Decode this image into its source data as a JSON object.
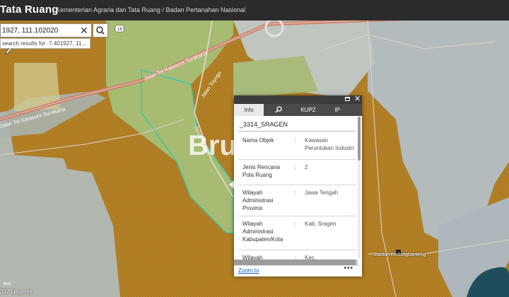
{
  "header": {
    "title": "Tata Ruang",
    "subtitle": "Kementerian Agraria dan Tata Ruang / Badan Pertanahan Nasional"
  },
  "search": {
    "value": "1927, 111.102020",
    "suggestion": "search results for -7.401927, 11..."
  },
  "map": {
    "road_labels": {
      "road_1": "Jalan Tol Katasura Surakarta",
      "road_2": "Jalan Tol Katasura Surakarta",
      "road_3": "Jalan Toyogo",
      "road_4": "Jalan Toyogo",
      "route_shield": "16"
    },
    "watermark": "Bru",
    "station_label": "Stasiun Kedungbanteng",
    "scale_text": "4km",
    "coordinate_readout": "397 Degrees",
    "colors": {
      "industrial_zone": "#c8bf87",
      "green_zone": "#9fb66e",
      "agriculture_zone": "#b9c1c3",
      "settlement_zone": "#b88427",
      "highway": "#c8826f",
      "zone_boundary": "#37c8ad"
    }
  },
  "popup": {
    "tabs": {
      "info": "Info",
      "search_icon": "search-icon",
      "kupz": "KUPZ",
      "ip": "IP"
    },
    "feature_title": "_3314_SRAGEN",
    "attributes": [
      {
        "label": "Nama Objek",
        "value": "Kawasan Peruntukan Industri"
      },
      {
        "label": "Jenis Rencana Pola Ruang",
        "value": "2"
      },
      {
        "label": "Wilayah Administrasi Provinsi",
        "value": "Jawa Tengah"
      },
      {
        "label": "Wilayah Administrasi Kabupaten/Kota",
        "value": "Kab. Sragen"
      },
      {
        "label": "Wilayah",
        "value": "Kec. Sembungmacan"
      }
    ],
    "zoom_to": "Zoom to",
    "more": "•••"
  }
}
